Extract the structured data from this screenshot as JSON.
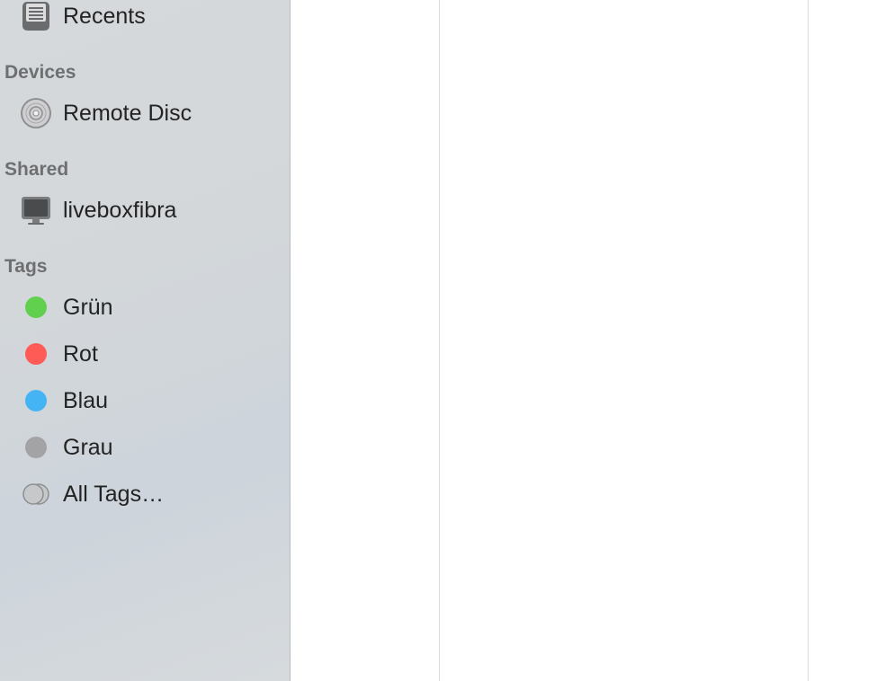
{
  "sidebar": {
    "favorites": [
      {
        "label": "Recents",
        "icon": "recents-icon"
      }
    ],
    "devices": {
      "header": "Devices",
      "items": [
        {
          "label": "Remote Disc",
          "icon": "disc-icon"
        }
      ]
    },
    "shared": {
      "header": "Shared",
      "items": [
        {
          "label": "liveboxfibra",
          "icon": "computer-icon"
        }
      ]
    },
    "tags": {
      "header": "Tags",
      "items": [
        {
          "label": "Grün",
          "color": "#62d04f"
        },
        {
          "label": "Rot",
          "color": "#fe5b57"
        },
        {
          "label": "Blau",
          "color": "#44b4f5"
        },
        {
          "label": "Grau",
          "color": "#a3a3a5"
        },
        {
          "label": "All Tags…",
          "icon": "all-tags-icon"
        }
      ]
    }
  }
}
